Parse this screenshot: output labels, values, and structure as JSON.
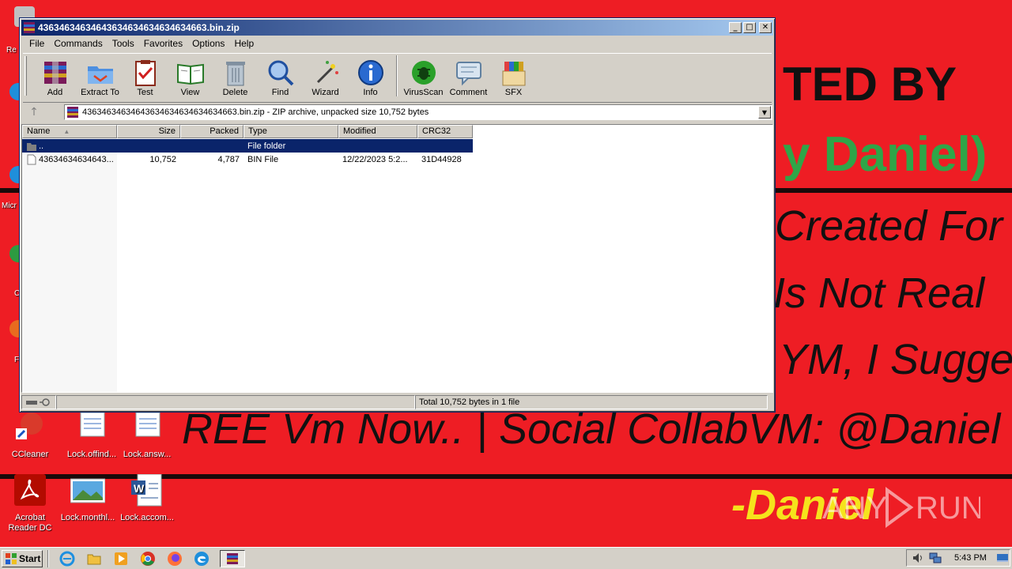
{
  "wallpaper": {
    "heading": "TED BY",
    "daniel": "y Daniel)",
    "created": "Created For",
    "not_real": "Is Not Real",
    "suggest": "YM, I Sugge",
    "social": "REE Vm Now.. | Social CollabVM: @Daniel",
    "sign": "-Daniel",
    "watermark": "ANY RUN"
  },
  "desktop_icons": [
    {
      "label": "CCleaner"
    },
    {
      "label": "Lock.offind..."
    },
    {
      "label": "Lock.answ..."
    },
    {
      "label": "Acrobat Reader DC"
    },
    {
      "label": "Lock.monthl..."
    },
    {
      "label": "Lock.accom..."
    }
  ],
  "edge_labels": [
    "Re",
    "Micr",
    "C",
    "F"
  ],
  "window": {
    "title": "43634634634643634634634634634663.bin.zip",
    "menu": [
      "File",
      "Commands",
      "Tools",
      "Favorites",
      "Options",
      "Help"
    ],
    "toolbar": [
      "Add",
      "Extract To",
      "Test",
      "View",
      "Delete",
      "Find",
      "Wizard",
      "Info",
      "VirusScan",
      "Comment",
      "SFX"
    ],
    "address": "43634634634643634634634634634663.bin.zip - ZIP archive, unpacked size 10,752 bytes",
    "columns": [
      "Name",
      "Size",
      "Packed",
      "Type",
      "Modified",
      "CRC32"
    ],
    "rows": [
      {
        "name": "..",
        "size": "",
        "packed": "",
        "type": "File folder",
        "modified": "",
        "crc": ""
      },
      {
        "name": "43634634634643...",
        "size": "10,752",
        "packed": "4,787",
        "type": "BIN File",
        "modified": "12/22/2023 5:2...",
        "crc": "31D44928"
      }
    ],
    "status": "Total 10,752 bytes in 1 file"
  },
  "taskbar": {
    "start": "Start",
    "clock": "5:43 PM"
  },
  "colors": {
    "wallpaper": "#ee1d24",
    "titlebar_start": "#0a246a",
    "titlebar_end": "#a6caf0",
    "selection": "#0a246a",
    "wallpaper_green": "#2fa548",
    "wallpaper_yellow": "#f5e31c"
  }
}
